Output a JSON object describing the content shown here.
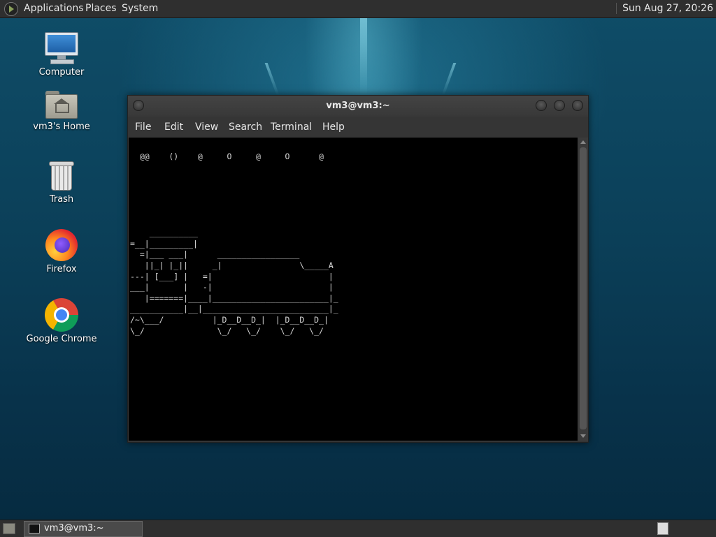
{
  "top_panel": {
    "menus": [
      "Applications",
      "Places",
      "System"
    ],
    "clock": "Sun Aug 27, 20:26"
  },
  "desktop": {
    "icons": [
      {
        "label": "Computer",
        "icon": "monitor-icon"
      },
      {
        "label": "vm3's Home",
        "icon": "home-folder-icon"
      },
      {
        "label": "Trash",
        "icon": "trash-icon"
      },
      {
        "label": "Firefox",
        "icon": "firefox-icon"
      },
      {
        "label": "Google Chrome",
        "icon": "chrome-icon"
      }
    ]
  },
  "window": {
    "title": "vm3@vm3:~",
    "menu": [
      "File",
      "Edit",
      "View",
      "Search",
      "Terminal",
      "Help"
    ],
    "terminal_text": "  @@    ()    @     O     @     O      @\n\n\n\n\n\n\n    __________\n=__|_________|\n  =|___ ___|      _________________\n   ||_| |_||     _|                \\_____A\n---| [___] |   =|                        |\n___|       |   -|                        |\n   |=======|____|________________________|_\n___________|__|__________________________|_\n/~\\___/          |_D__D__D_|  |_D__D__D_|\n\\_/               \\_/   \\_/    \\_/   \\_/"
  },
  "taskbar": {
    "task_label": "vm3@vm3:~"
  },
  "colors": {
    "panel": "#2f2f2f",
    "terminal_bg": "#000000",
    "desktop_accent": "#0f4d68"
  }
}
